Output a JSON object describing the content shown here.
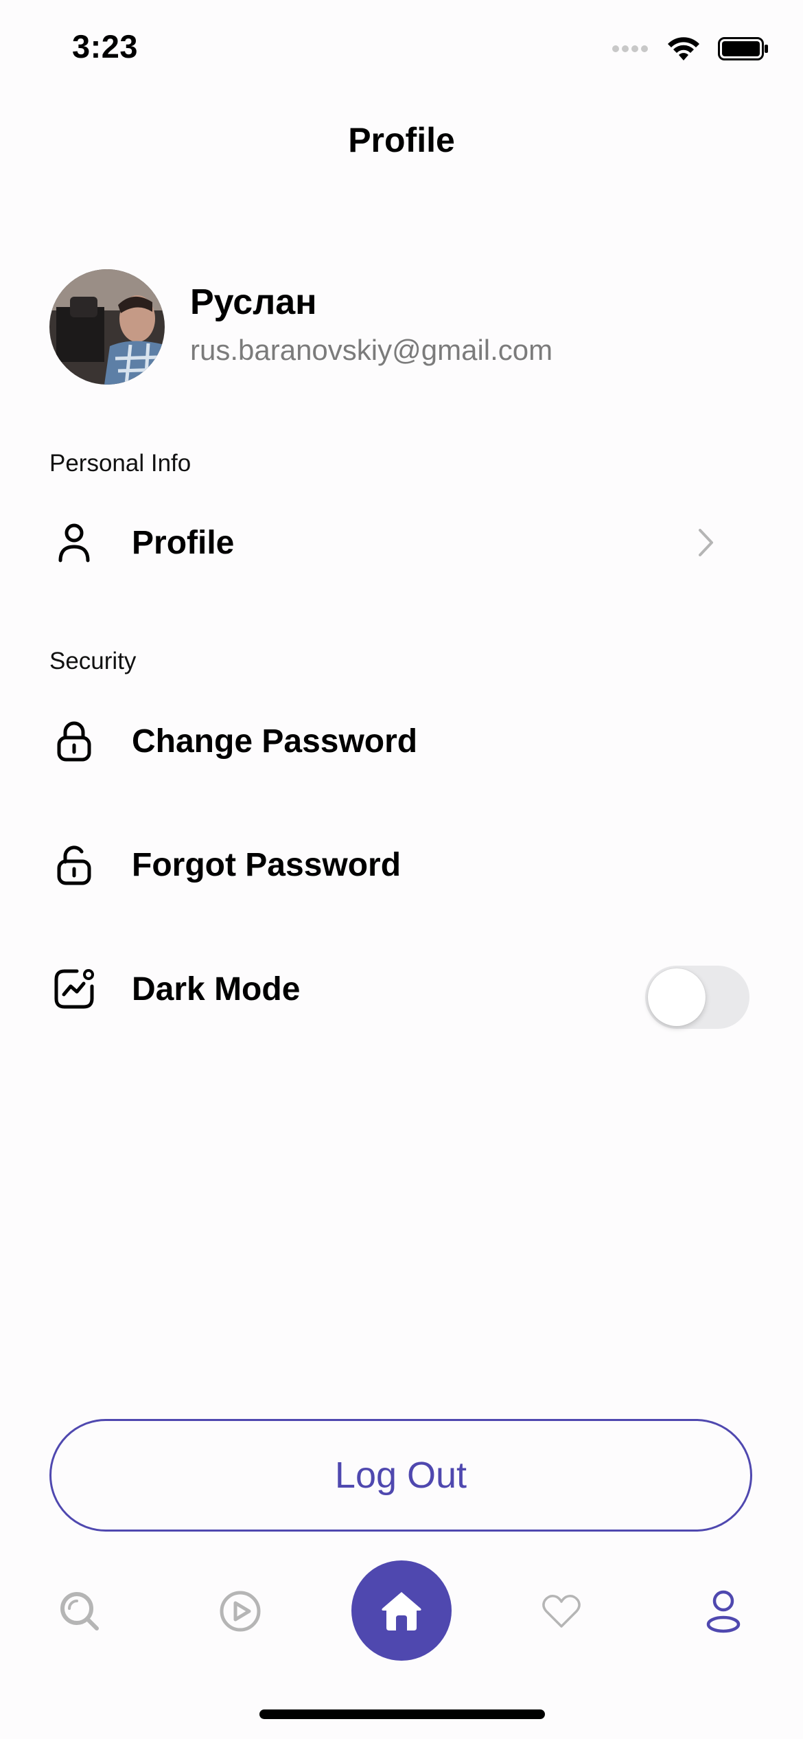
{
  "status_bar": {
    "time": "3:23"
  },
  "header": {
    "title": "Profile"
  },
  "user": {
    "name": "Руслан",
    "email": "rus.baranovskiy@gmail.com"
  },
  "sections": {
    "personal_info": {
      "label": "Personal Info",
      "items": [
        {
          "label": "Profile",
          "icon": "person-icon"
        }
      ]
    },
    "security": {
      "label": "Security",
      "items": [
        {
          "label": "Change Password",
          "icon": "lock-icon"
        },
        {
          "label": "Forgot Password",
          "icon": "unlock-icon"
        },
        {
          "label": "Dark Mode",
          "icon": "activity-icon",
          "toggle_on": false
        }
      ]
    }
  },
  "logout_label": "Log Out",
  "tab_bar": {
    "tabs": [
      {
        "icon": "search-icon",
        "active": false
      },
      {
        "icon": "play-icon",
        "active": false
      },
      {
        "icon": "home-icon",
        "active": true
      },
      {
        "icon": "heart-icon",
        "active": false
      },
      {
        "icon": "profile-icon",
        "active": false
      }
    ]
  },
  "colors": {
    "accent": "#4F48AF",
    "secondary_text": "#7B7B7B",
    "inactive_icon": "#B5B5B5",
    "toggle_off": "#E9E9EB"
  }
}
